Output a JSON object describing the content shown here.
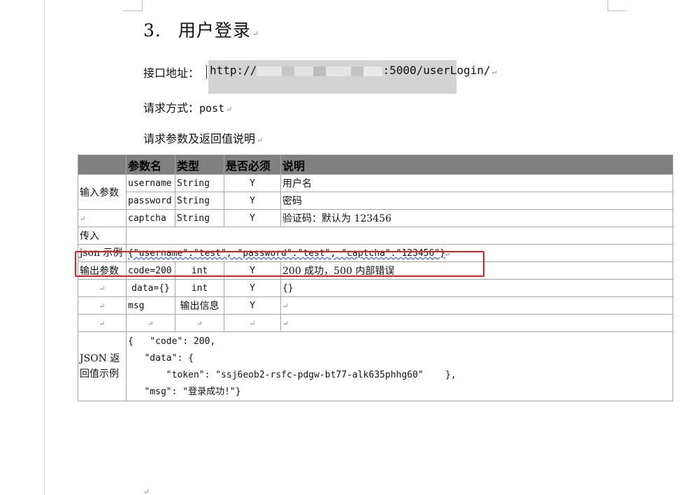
{
  "heading": {
    "number": "3.",
    "title": "用户登录"
  },
  "endpoint": {
    "label": "接口地址：",
    "prefix": "http://",
    "suffix": ":5000/userLogin/"
  },
  "method": {
    "label": "请求方式：",
    "value": "post"
  },
  "params_title": "请求参数及返回值说明",
  "paragraph_mark": "↵",
  "table": {
    "headers": [
      "",
      "参数名",
      "类型",
      "是否必须",
      "说明"
    ],
    "input_label": "输入参数",
    "input_rows": [
      {
        "name": "username",
        "type": "String",
        "required": "Y",
        "desc": "用户名"
      },
      {
        "name": "password",
        "type": "String",
        "required": "Y",
        "desc": "密码"
      },
      {
        "name": "captcha",
        "type": "String",
        "required": "Y",
        "desc": "验证码：默认为 123456"
      }
    ],
    "pass_label": "传入",
    "json_example_label": "json 示例",
    "json_example": "{\"username\":\"test\", \"password\":\"test\", \"captcha\":\"123456\"}",
    "output_label": "输出参数",
    "output_rows": [
      {
        "name": "code=200",
        "type": "int",
        "required": "Y",
        "desc": "200 成功，500 内部错误"
      },
      {
        "name": "data={}",
        "type": "int",
        "required": "Y",
        "desc": "{}"
      },
      {
        "name": "msg",
        "type": "输出信息",
        "required": "Y",
        "desc": ""
      }
    ],
    "return_label": "JSON 返回值示例",
    "return_lines": [
      "{   \"code\": 200,",
      "",
      "   \"data\": {",
      "",
      "       \"token\": \"ssj6eob2-rsfc-pdgw-bt77-alk635phhg60\"    },",
      "",
      "   \"msg\": \"登录成功!\"}"
    ]
  },
  "colors": {
    "header_bg": "#808080",
    "highlight": "#e02020",
    "redact": "#d3d3d3"
  }
}
